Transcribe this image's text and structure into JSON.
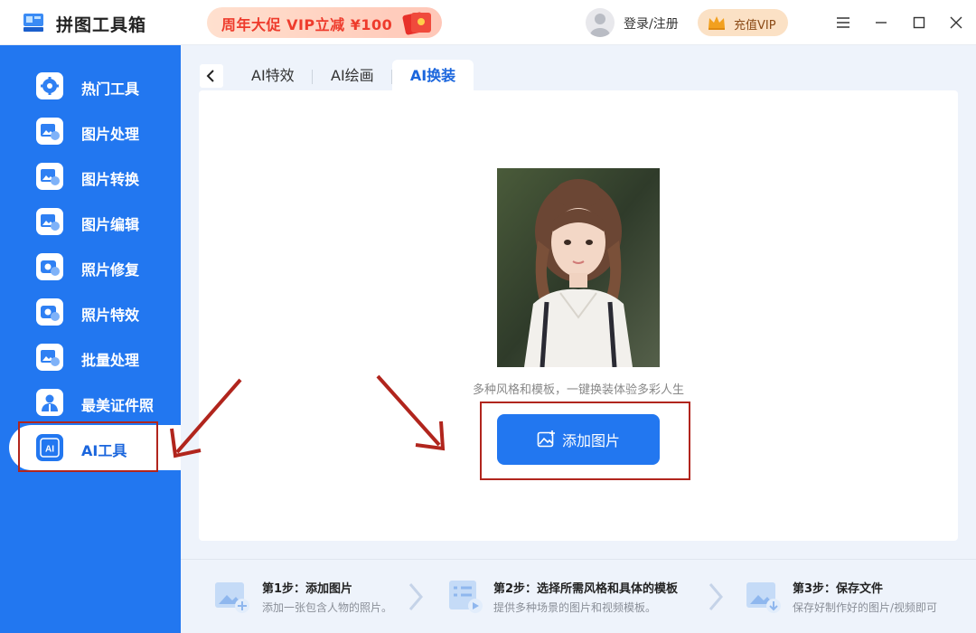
{
  "app": {
    "title": "拼图工具箱",
    "logo_icon": "toolbox-icon"
  },
  "promo": {
    "text": "周年大促 VIP立减 ¥100",
    "icon": "red-envelope-icon"
  },
  "account": {
    "login_label": "登录/注册",
    "vip_label": "充值VIP",
    "avatar_icon": "user-avatar-icon"
  },
  "window_controls": {
    "menu_icon": "menu-icon",
    "minimize_icon": "minimize-icon",
    "maximize_icon": "maximize-icon",
    "close_icon": "close-icon"
  },
  "sidebar": {
    "items": [
      {
        "label": "热门工具",
        "icon": "gear-icon"
      },
      {
        "label": "图片处理",
        "icon": "image-clock-icon"
      },
      {
        "label": "图片转换",
        "icon": "image-convert-icon"
      },
      {
        "label": "图片编辑",
        "icon": "image-edit-icon"
      },
      {
        "label": "照片修复",
        "icon": "camera-plus-icon"
      },
      {
        "label": "照片特效",
        "icon": "camera-magic-icon"
      },
      {
        "label": "批量处理",
        "icon": "image-batch-icon"
      },
      {
        "label": "最美证件照",
        "icon": "id-photo-icon"
      },
      {
        "label": "AI工具",
        "icon": "ai-icon",
        "active": true
      }
    ]
  },
  "tabs": [
    {
      "label": "AI特效"
    },
    {
      "label": "AI绘画"
    },
    {
      "label": "AI换装",
      "active": true
    }
  ],
  "main": {
    "subtitle": "多种风格和模板，一键换装体验多彩人生",
    "add_button_label": "添加图片",
    "add_button_icon": "add-image-icon"
  },
  "steps": [
    {
      "title": "第1步：添加图片",
      "desc": "添加一张包含人物的照片。",
      "icon": "add-image-step-icon"
    },
    {
      "title": "第2步：选择所需风格和具体的模板",
      "desc": "提供多种场景的图片和视频模板。",
      "icon": "template-step-icon"
    },
    {
      "title": "第3步：保存文件",
      "desc": "保存好制作好的图片/视频即可",
      "icon": "download-step-icon"
    }
  ],
  "colors": {
    "primary": "#2277f0",
    "annotation_red": "#b1251d",
    "promo_red": "#ee3b2c",
    "vip_bg": "#fbe1c5"
  }
}
